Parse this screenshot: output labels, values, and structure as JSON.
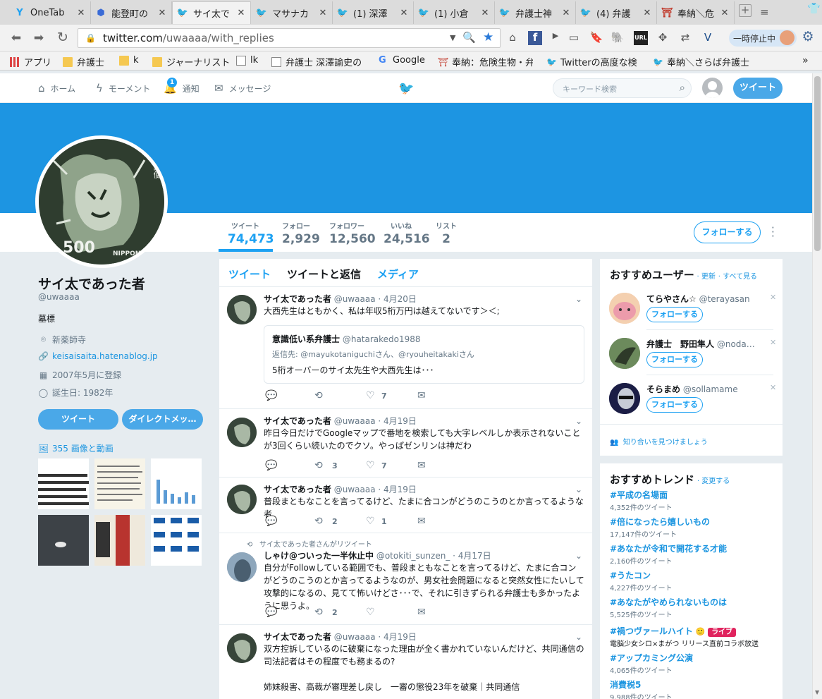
{
  "browser": {
    "tabs": [
      {
        "title": "OneTab",
        "icon": "onetab-icon",
        "active": false
      },
      {
        "title": "能登町の",
        "icon": "cube-icon",
        "active": false
      },
      {
        "title": "サイ太で",
        "icon": "twitter-icon",
        "active": true
      },
      {
        "title": "マサナカ",
        "icon": "twitter-icon",
        "active": false
      },
      {
        "title": "(1) 深澤",
        "icon": "twitter-icon",
        "active": false
      },
      {
        "title": "(1) 小倉",
        "icon": "twitter-icon",
        "active": false
      },
      {
        "title": "弁護士神",
        "icon": "twitter-icon",
        "active": false
      },
      {
        "title": "(4) 弁護",
        "icon": "twitter-icon",
        "active": false
      },
      {
        "title": "奉納＼危",
        "icon": "shrine-icon",
        "active": false
      }
    ],
    "url_domain": "twitter.com",
    "url_path": "/uwaaaa/with_replies",
    "pause_label": "一時停止中",
    "bookmarks": [
      {
        "label": "アプリ",
        "icon": "apps-grid-icon"
      },
      {
        "label": "弁護士",
        "icon": "folder-icon"
      },
      {
        "label": "k",
        "icon": "folder-icon"
      },
      {
        "label": "ジャーナリスト",
        "icon": "folder-icon"
      },
      {
        "label": "lk",
        "icon": "page-icon"
      },
      {
        "label": "弁護士 深澤諭史の",
        "icon": "page-icon"
      },
      {
        "label": "Google",
        "icon": "google-icon"
      },
      {
        "label": "奉納：危険生物・弁護",
        "icon": "shrine-icon"
      },
      {
        "label": "Twitterの高度な検",
        "icon": "twitter-icon"
      },
      {
        "label": "奉納＼さらば弁護士",
        "icon": "twitter-icon"
      }
    ]
  },
  "header": {
    "home": "ホーム",
    "moments": "モーメント",
    "notifications": "通知",
    "notifications_badge": "1",
    "messages": "メッセージ",
    "search_placeholder": "キーワード検索",
    "tweet_button": "ツイート"
  },
  "profile": {
    "stats": [
      {
        "label": "ツイート",
        "value": "74,473"
      },
      {
        "label": "フォロー",
        "value": "2,929"
      },
      {
        "label": "フォロワー",
        "value": "12,560"
      },
      {
        "label": "いいね",
        "value": "24,516"
      },
      {
        "label": "リスト",
        "value": "2"
      }
    ],
    "follow_button": "フォローする",
    "name": "サイ太であった者",
    "handle": "@uwaaaa",
    "bio": "墓標",
    "location": "新薬師寺",
    "website": "keisaisaita.hatenablog.jp",
    "joined": "2007年5月に登録",
    "birthday": "誕生日: 1982年",
    "tweet_btn": "ツイート",
    "dm_btn": "ダイレクトメッ…",
    "media_link": "355 画像と動画",
    "avatar_stamp_text": "500",
    "avatar_stamp_country": "NIPPON",
    "avatar_stamp_jp": "日本郵便"
  },
  "timeline": {
    "tabs": [
      "ツイート",
      "ツイートと返信",
      "メディア"
    ],
    "tweets": [
      {
        "name": "サイ太であった者",
        "handle": "@uwaaaa",
        "date": "· 4月20日",
        "text": "大西先生はともかく、私は年収5桁万円は越えてないです＞＜;",
        "quote": {
          "name": "意識低い系弁護士",
          "handle": "@hatarakedo1988",
          "reply_to": "返信先: @mayukotaniguchiさん、@ryouheitakakiさん",
          "text": "5桁オーバーのサイ太先生や大西先生は･･･"
        },
        "retweets": "",
        "likes": "7"
      },
      {
        "name": "サイ太であった者",
        "handle": "@uwaaaa",
        "date": "· 4月19日",
        "text": "昨日今日だけでGoogleマップで番地を検索しても大字レベルしか表示されないことが3回くらい続いたのでクソ。やっぱゼンリンは神だわ",
        "retweets": "3",
        "likes": "7"
      },
      {
        "name": "サイ太であった者",
        "handle": "@uwaaaa",
        "date": "· 4月19日",
        "text": "普段まともなことを言ってるけど、たまに合コンがどうのこうのとか言ってるような者",
        "retweets": "2",
        "likes": "1"
      },
      {
        "retweet_context": "サイ太であった者さんがリツイート",
        "name": "しゃけ@ついった一半休止中",
        "handle": "@otokiti_sunzen_",
        "date": "· 4月17日",
        "text": "自分がFollowしている範囲でも、普段まともなことを言ってるけど、たまに合コンがどうのこうのとか言ってるようなのが、男女社会問題になると突然女性にたいして攻撃的になるの、見てて怖いけどさ･･･で、それに引きずられる弁護士も多かったように思うよ。",
        "retweets": "2",
        "likes": ""
      },
      {
        "name": "サイ太であった者",
        "handle": "@uwaaaa",
        "date": "· 4月19日",
        "text": "双方控訴しているのに破棄になった理由が全く書かれていないんだけど、共同通信の司法記者はその程度でも務まるの?",
        "text2": "姉妹殺害、高裁が審理差し戻し　一審の懲役23年を破棄｜共同通信"
      }
    ]
  },
  "sidebar": {
    "who_to_follow_title": "おすすめユーザー",
    "refresh": "· 更新",
    "view_all": "· すべて見る",
    "suggestions": [
      {
        "name": "てらやさん☆",
        "handle": "@terayasan",
        "button": "フォローする"
      },
      {
        "name": "弁護士　野田隼人",
        "handle": "@noda…",
        "button": "フォローする"
      },
      {
        "name": "そらまめ",
        "handle": "@sollamame",
        "button": "フォローする"
      }
    ],
    "find_friends": "知り合いを見つけましょう",
    "trends_title": "おすすめトレンド",
    "trends_change": "· 変更する",
    "trends": [
      {
        "name": "#平成の名場面",
        "count": "4,352件のツイート"
      },
      {
        "name": "#倍になったら嬉しいもの",
        "count": "17,147件のツイート"
      },
      {
        "name": "#あなたが令和で開花する才能",
        "count": "2,160件のツイート"
      },
      {
        "name": "#うたコン",
        "count": "4,227件のツイート"
      },
      {
        "name": "#あなたがやめられないものは",
        "count": "5,525件のツイート"
      },
      {
        "name": "#禍つヴァールハイト",
        "count": "電脳少女シロ×まがつ リリース直前コラボ放送",
        "badge": "ライブ"
      },
      {
        "name": "#アップカミング公演",
        "count": "4,065件のツイート"
      },
      {
        "name": "消費税5",
        "count": "9,988件のツイート"
      }
    ]
  },
  "colors": {
    "twitter_blue": "#1da1f2",
    "banner": "#1d95e2",
    "live_badge": "#e0245e"
  }
}
